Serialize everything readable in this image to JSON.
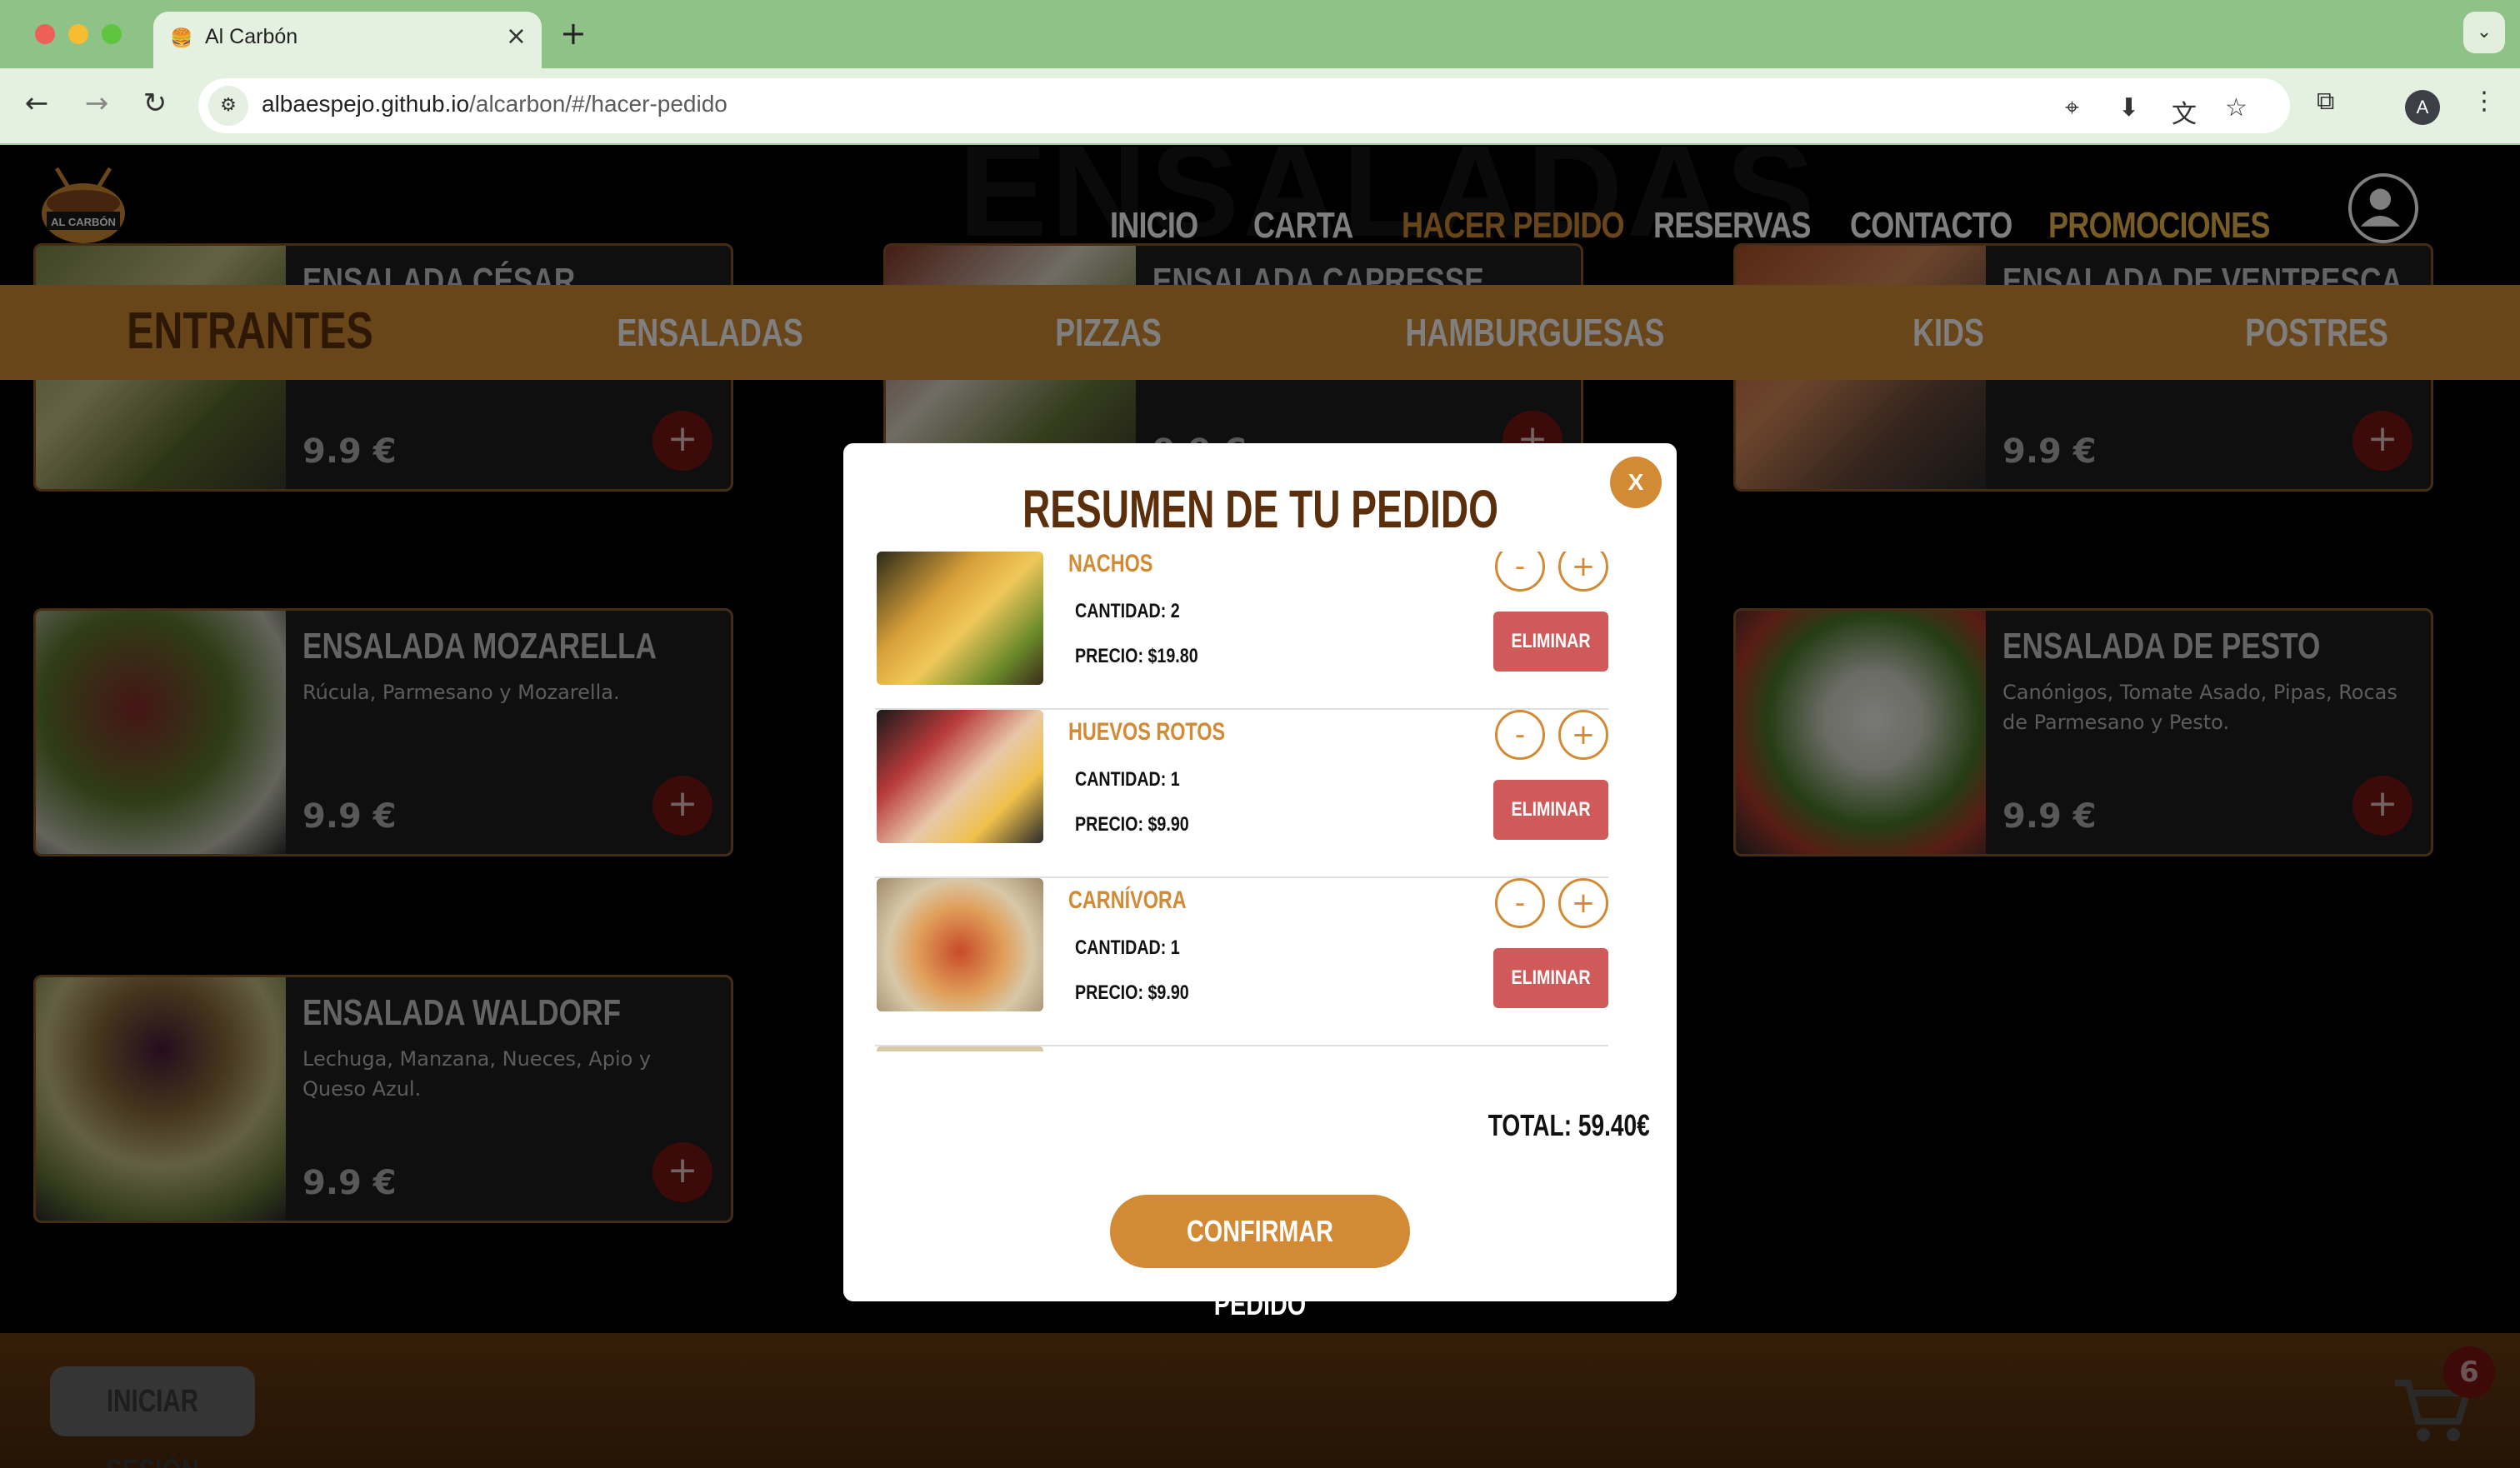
{
  "browser": {
    "tab_title": "Al Carbón",
    "url_host": "albaespejo.github.io",
    "url_path": "/alcarbon/#/hacer-pedido",
    "profile_initial": "A"
  },
  "nav": {
    "logo_text": "AL CARBÓN",
    "links": [
      "INICIO",
      "CARTA",
      "HACER PEDIDO",
      "RESERVAS",
      "CONTACTO",
      "PROMOCIONES"
    ]
  },
  "section_title": "ENSALADAS",
  "categories": [
    "ENTRANTES",
    "ENSALADAS",
    "PIZZAS",
    "HAMBURGUESAS",
    "KIDS",
    "POSTRES"
  ],
  "cards": [
    {
      "name": "ENSALADA CÉSAR",
      "desc": "",
      "price": "9.9 €"
    },
    {
      "name": "ENSALADA CAPRESSE",
      "desc": "",
      "price": "9.9 €"
    },
    {
      "name": "ENSALADA DE VENTRESCA",
      "desc": "",
      "price": "9.9 €"
    },
    {
      "name": "ENSALADA MOZARELLA",
      "desc": "Rúcula, Parmesano y Mozarella.",
      "price": "9.9 €"
    },
    {
      "name": "ENSALADA DE PESTO",
      "desc": "Canónigos, Tomate Asado, Pipas, Rocas de Parmesano y Pesto.",
      "price": "9.9 €"
    },
    {
      "name": "ENSALADA WALDORF",
      "desc": "Lechuga, Manzana, Nueces, Apio y Queso Azul.",
      "price": "9.9 €"
    }
  ],
  "modal": {
    "close_label": "X",
    "title": "RESUMEN DE TU PEDIDO",
    "items": [
      {
        "name": "NACHOS",
        "qty": "CANTIDAD: 2",
        "price": "PRECIO: $19.80"
      },
      {
        "name": "HUEVOS ROTOS",
        "qty": "CANTIDAD: 1",
        "price": "PRECIO: $9.90"
      },
      {
        "name": "CARNÍVORA",
        "qty": "CANTIDAD: 1",
        "price": "PRECIO: $9.90"
      }
    ],
    "minus_label": "-",
    "plus_label": "+",
    "delete_label": "ELIMINAR",
    "total": "TOTAL: 59.40€",
    "confirm_label": "CONFIRMAR PEDIDO"
  },
  "footer": {
    "login_label": "INICIAR SESIÓN",
    "cart_count": "6"
  },
  "colors": {
    "accent": "#d38a35",
    "brown": "#5c2f0c",
    "delete": "#d05a5a",
    "chrome": "#8fc286"
  }
}
